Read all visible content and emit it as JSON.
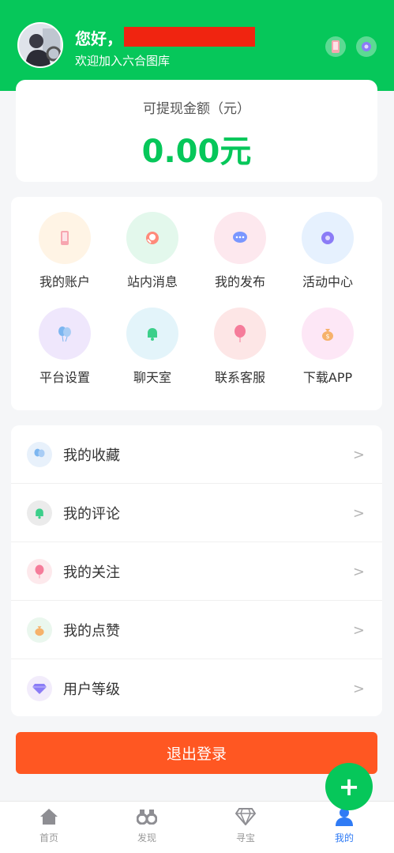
{
  "header": {
    "greeting": "您好，",
    "subtitle": "欢迎加入六合图库"
  },
  "balance": {
    "label": "可提现金额（元）",
    "amount": "0.00元"
  },
  "grid": [
    {
      "label": "我的账户",
      "icon": "phone-icon",
      "bg": "#fff4e5",
      "fg": "#f7a6b0"
    },
    {
      "label": "站内消息",
      "icon": "message-icon",
      "bg": "#e3f8ec",
      "fg": "#ff6b6b"
    },
    {
      "label": "我的发布",
      "icon": "chat-bubble-icon",
      "bg": "#fde8ee",
      "fg": "#6c8cff"
    },
    {
      "label": "活动中心",
      "icon": "gear-icon",
      "bg": "#e6f1fe",
      "fg": "#8b7cf6"
    },
    {
      "label": "平台设置",
      "icon": "balloons-icon",
      "bg": "#efe7fc",
      "fg": "#7cb6f0"
    },
    {
      "label": "聊天室",
      "icon": "bell-icon",
      "bg": "#e3f4fa",
      "fg": "#3ccf8a"
    },
    {
      "label": "联系客服",
      "icon": "balloon-icon",
      "bg": "#fde6e6",
      "fg": "#f57c9a"
    },
    {
      "label": "下载APP",
      "icon": "money-bag-icon",
      "bg": "#fde7f6",
      "fg": "#f6b26b"
    }
  ],
  "list": [
    {
      "label": "我的收藏",
      "icon": "balloons-icon",
      "bg": "#e8f1fb",
      "fg": "#7cb6f0"
    },
    {
      "label": "我的评论",
      "icon": "bell-icon",
      "bg": "#ebebeb",
      "fg": "#3ccf8a"
    },
    {
      "label": "我的关注",
      "icon": "balloon-icon",
      "bg": "#fde9ec",
      "fg": "#f57c9a"
    },
    {
      "label": "我的点赞",
      "icon": "money-bag-icon",
      "bg": "#eaf7ee",
      "fg": "#f6b26b"
    },
    {
      "label": "用户等级",
      "icon": "gem-icon",
      "bg": "#f2ecfb",
      "fg": "#8b7cf6"
    }
  ],
  "chevron": ">",
  "logout_label": "退出登录",
  "fab_label": "+",
  "tabs": [
    {
      "label": "首页",
      "icon": "home-icon"
    },
    {
      "label": "发现",
      "icon": "binoculars-icon"
    },
    {
      "label": "寻宝",
      "icon": "diamond-icon"
    },
    {
      "label": "我的",
      "icon": "user-icon",
      "active": true
    }
  ],
  "colors": {
    "brand": "#06c75a",
    "logout": "#ff5722",
    "active_tab": "#2f7bf5"
  }
}
